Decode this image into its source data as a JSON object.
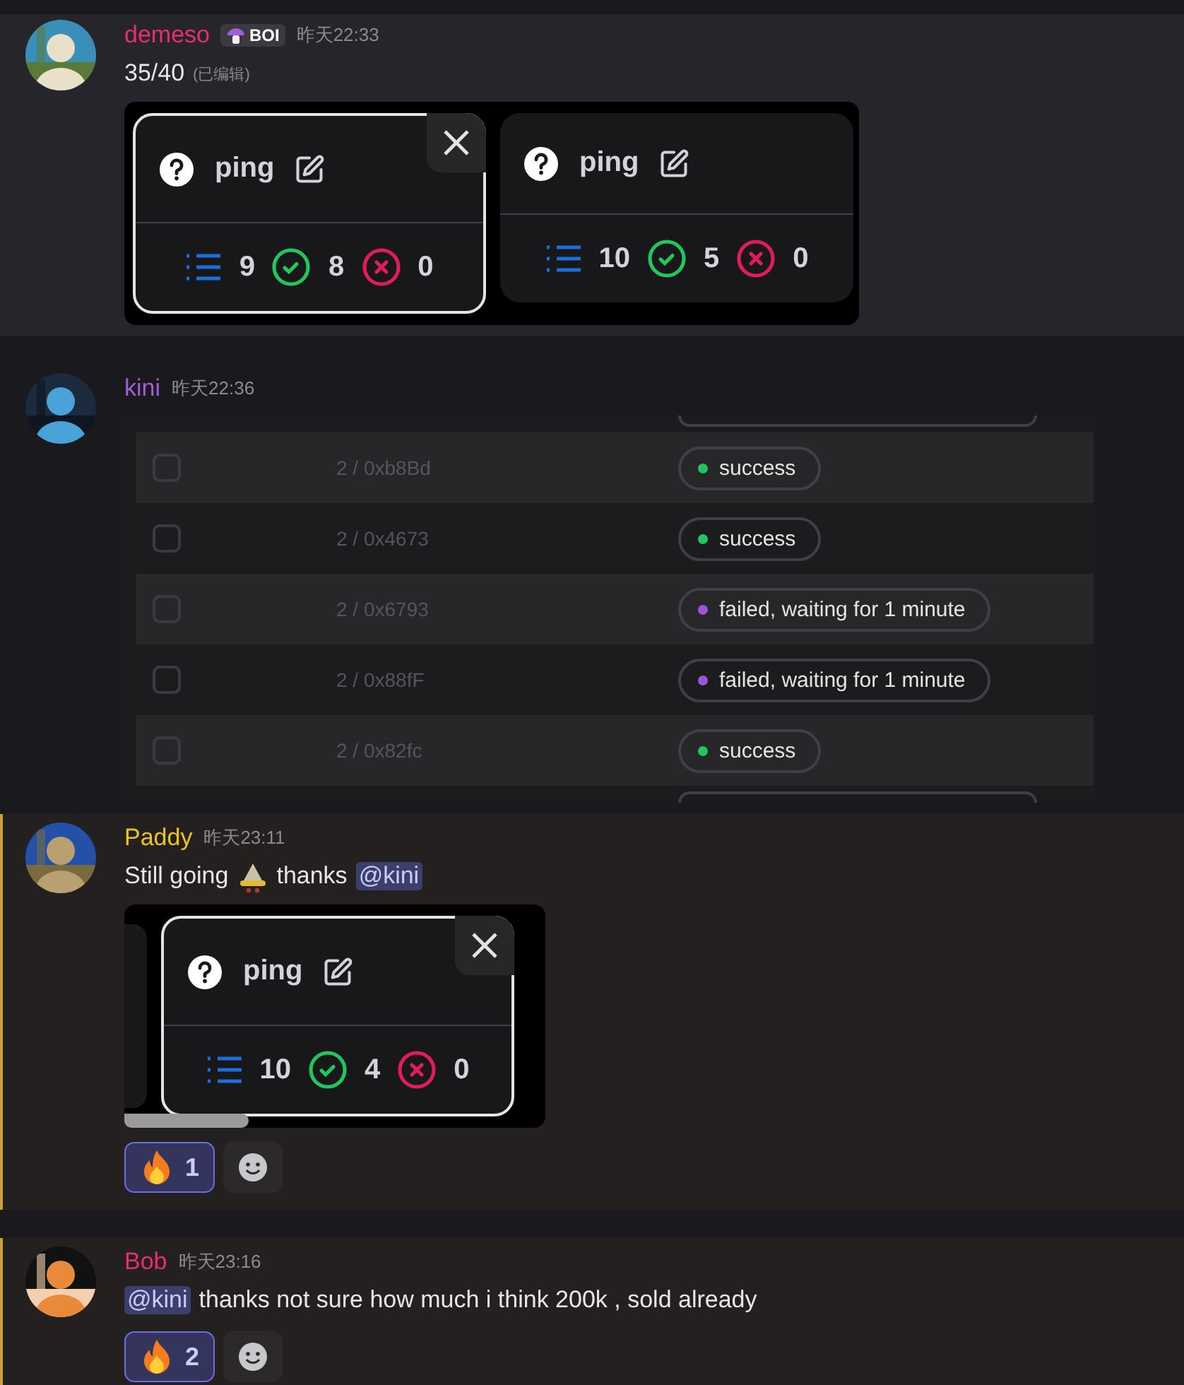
{
  "messages": [
    {
      "author": "demeso",
      "color": "#e5306d",
      "badge": "BOI",
      "time": "昨天22:33",
      "hovered": true,
      "mentioned": false,
      "text": [
        {
          "kind": "text",
          "value": "35/40"
        }
      ],
      "edited": "(已编辑)",
      "attachment": {
        "kind": "cards",
        "cropped": false,
        "cards": [
          {
            "title": "ping",
            "focused": true,
            "closable": true,
            "total": "9",
            "passed": "8",
            "failed": "0"
          },
          {
            "title": "ping",
            "focused": false,
            "closable": false,
            "total": "10",
            "passed": "5",
            "failed": "0"
          }
        ]
      }
    },
    {
      "author": "kini",
      "color": "#a15ed6",
      "time": "昨天22:36",
      "hovered": false,
      "mentioned": false,
      "attachment": {
        "kind": "table",
        "rows": [
          {
            "id": "2 / 0xb8Bd",
            "status": "success",
            "color": "#22c55e",
            "checked": false
          },
          {
            "id": "2 / 0x4673",
            "status": "success",
            "color": "#22c55e",
            "checked": false
          },
          {
            "id": "2 / 0x6793",
            "status": "failed, waiting for 1 minute",
            "color": "#9b55d8",
            "checked": false
          },
          {
            "id": "2 / 0x88fF",
            "status": "failed, waiting for 1 minute",
            "color": "#9b55d8",
            "checked": false
          },
          {
            "id": "2 / 0x82fc",
            "status": "success",
            "color": "#22c55e",
            "checked": false
          }
        ]
      }
    },
    {
      "author": "Paddy",
      "color": "#e8c524",
      "time": "昨天23:11",
      "hovered": false,
      "mentioned": true,
      "text": [
        {
          "kind": "text",
          "value": "Still going"
        },
        {
          "kind": "emoji"
        },
        {
          "kind": "text",
          "value": "thanks"
        },
        {
          "kind": "mention",
          "value": "@kini"
        }
      ],
      "attachment": {
        "kind": "cards",
        "cropped": true,
        "cards": [
          {
            "title": "ping",
            "focused": true,
            "closable": true,
            "total": "10",
            "passed": "4",
            "failed": "0"
          }
        ]
      },
      "reactions": [
        {
          "count": "1",
          "selected": true
        }
      ]
    },
    {
      "author": "Bob",
      "color": "#e5306d",
      "time": "昨天23:16",
      "hovered": false,
      "mentioned": true,
      "text": [
        {
          "kind": "mention",
          "value": "@kini"
        },
        {
          "kind": "text",
          "value": "thanks not sure how much i think 200k , sold already"
        }
      ],
      "reactions": [
        {
          "count": "2",
          "selected": true
        }
      ]
    }
  ]
}
